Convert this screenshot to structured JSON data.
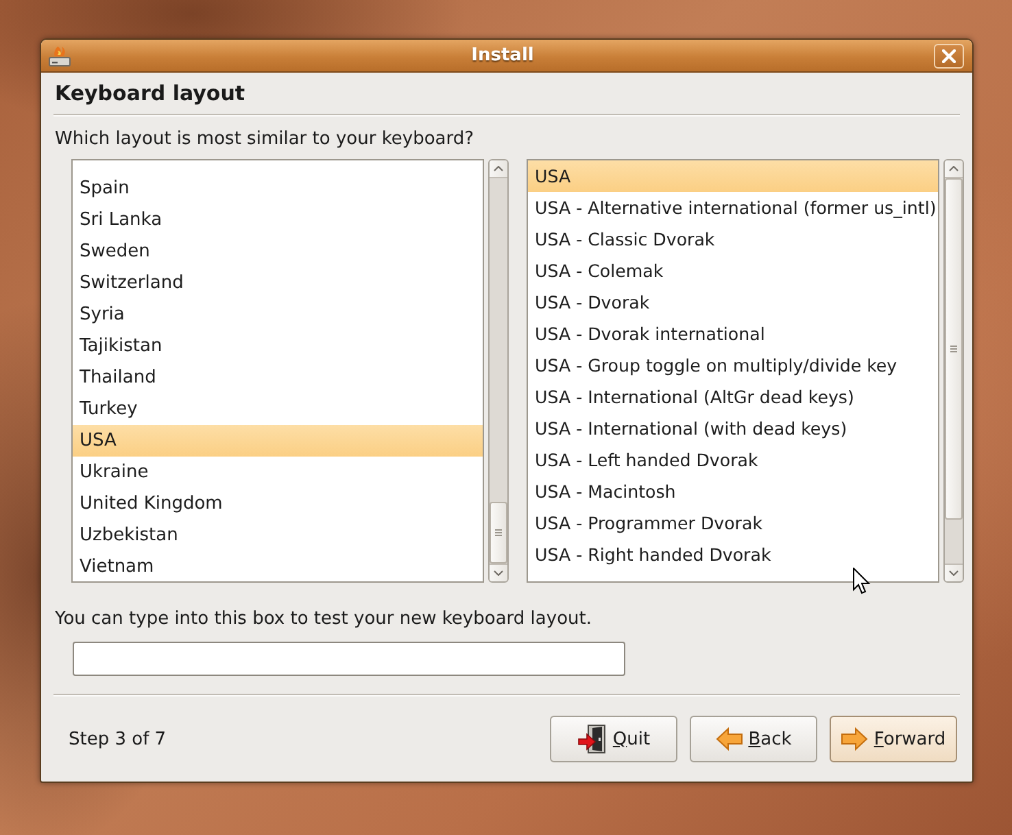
{
  "window": {
    "title": "Install"
  },
  "page": {
    "heading": "Keyboard layout",
    "prompt": "Which layout is most similar to your keyboard?"
  },
  "countries": {
    "items": [
      {
        "label": "Spain",
        "selected": false
      },
      {
        "label": "Sri Lanka",
        "selected": false
      },
      {
        "label": "Sweden",
        "selected": false
      },
      {
        "label": "Switzerland",
        "selected": false
      },
      {
        "label": "Syria",
        "selected": false
      },
      {
        "label": "Tajikistan",
        "selected": false
      },
      {
        "label": "Thailand",
        "selected": false
      },
      {
        "label": "Turkey",
        "selected": false
      },
      {
        "label": "USA",
        "selected": true
      },
      {
        "label": "Ukraine",
        "selected": false
      },
      {
        "label": "United Kingdom",
        "selected": false
      },
      {
        "label": "Uzbekistan",
        "selected": false
      },
      {
        "label": "Vietnam",
        "selected": false
      }
    ]
  },
  "variants": {
    "items": [
      {
        "label": "USA",
        "selected": true
      },
      {
        "label": "USA - Alternative international (former us_intl)",
        "selected": false
      },
      {
        "label": "USA - Classic Dvorak",
        "selected": false
      },
      {
        "label": "USA - Colemak",
        "selected": false
      },
      {
        "label": "USA - Dvorak",
        "selected": false
      },
      {
        "label": "USA - Dvorak international",
        "selected": false
      },
      {
        "label": "USA - Group toggle on multiply/divide key",
        "selected": false
      },
      {
        "label": "USA - International (AltGr dead keys)",
        "selected": false
      },
      {
        "label": "USA - International (with dead keys)",
        "selected": false
      },
      {
        "label": "USA - Left handed Dvorak",
        "selected": false
      },
      {
        "label": "USA - Macintosh",
        "selected": false
      },
      {
        "label": "USA - Programmer Dvorak",
        "selected": false
      },
      {
        "label": "USA - Right handed Dvorak",
        "selected": false
      }
    ]
  },
  "test": {
    "label": "You can type into this box to test your new keyboard layout."
  },
  "footer": {
    "step": "Step 3 of 7",
    "buttons": [
      {
        "kind": "quit",
        "label": "Quit",
        "mnemonic": true,
        "default": false
      },
      {
        "kind": "back",
        "label": "Back",
        "mnemonic": true,
        "default": false
      },
      {
        "kind": "forward",
        "label": "Forward",
        "mnemonic": true,
        "default": true
      }
    ]
  }
}
